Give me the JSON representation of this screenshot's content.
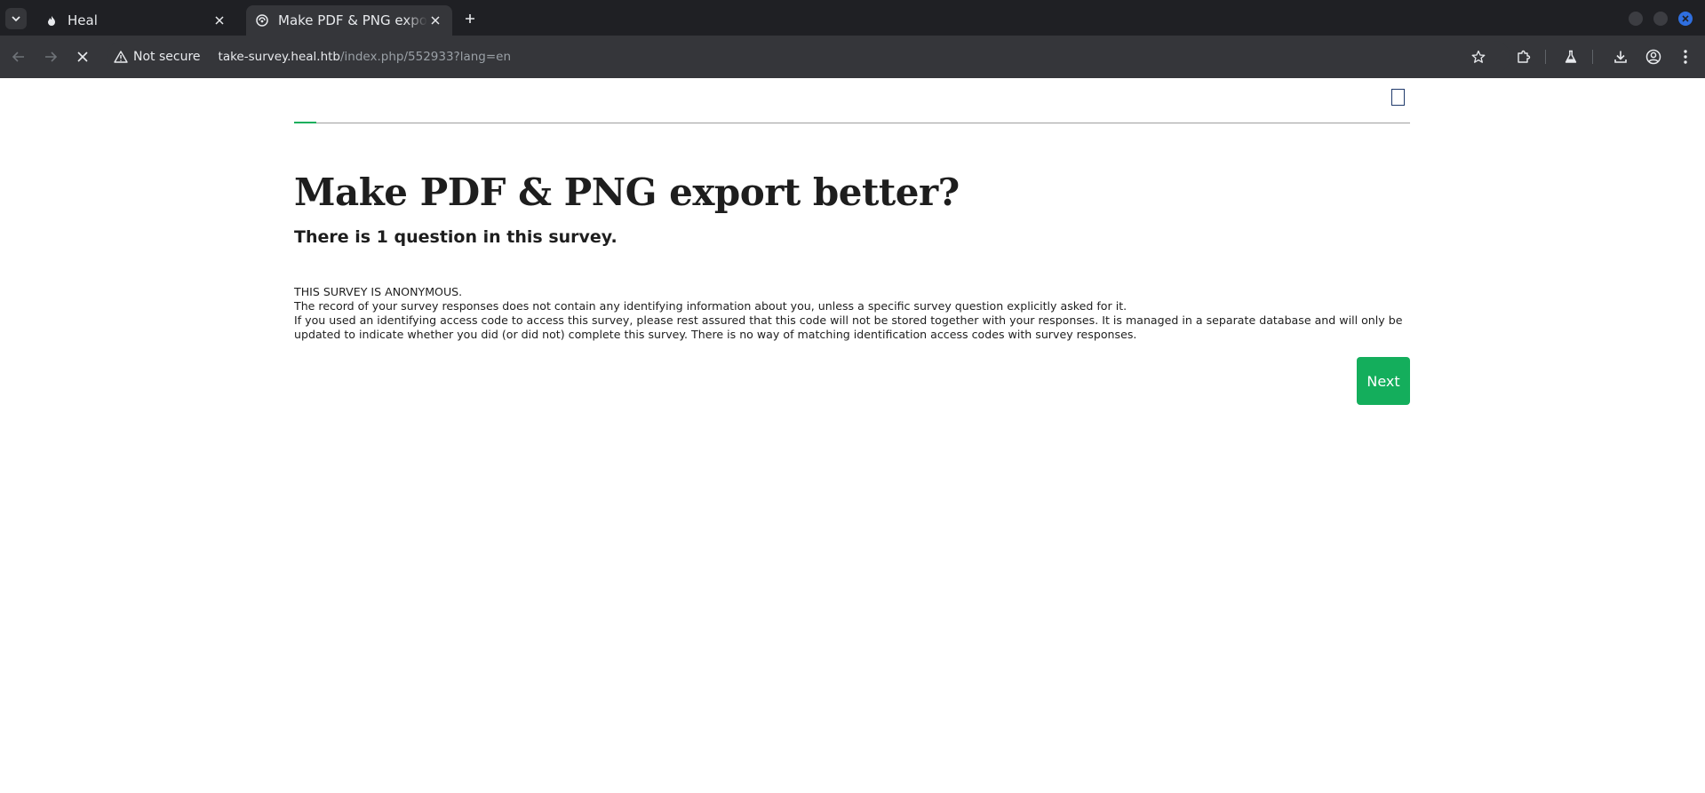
{
  "browser": {
    "tabs": [
      {
        "title": "Heal",
        "favicon": "flame-icon",
        "active": false
      },
      {
        "title": "Make PDF & PNG export better?",
        "favicon": "survey-icon",
        "active": true
      }
    ],
    "address_bar": {
      "security_label": "Not secure",
      "url_host": "take-survey.heal.htb",
      "url_path": "/index.php/552933?lang=en"
    },
    "accent_color": "#2f6fe0"
  },
  "survey": {
    "progress_percent": 2,
    "title": "Make PDF & PNG export better?",
    "question_count_text": "There is 1 question in this survey.",
    "anonymous_heading": "THIS SURVEY IS ANONYMOUS.",
    "anonymous_lines": [
      "The record of your survey responses does not contain any identifying information about you, unless a specific survey question explicitly asked for it.",
      "If you used an identifying access code to access this survey, please rest assured that this code will not be stored together with your responses. It is managed in a separate database and will only be updated to indicate whether you did (or did not) complete this survey. There is no way of matching identification access codes with survey responses."
    ],
    "next_label": "Next",
    "brand_color": "#14ae5c"
  }
}
